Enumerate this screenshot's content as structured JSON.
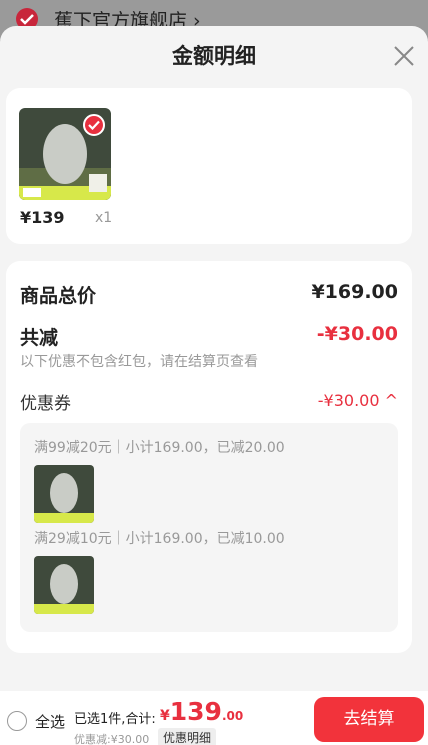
{
  "background": {
    "shop_name": "蕉下官方旗舰店 ›"
  },
  "sheet": {
    "title": "金额明细"
  },
  "product": {
    "price": "¥139",
    "qty": "x1"
  },
  "detail": {
    "total_label": "商品总价",
    "total_value": "¥169.00",
    "reduce_label": "共减",
    "reduce_value": "-¥30.00",
    "reduce_note": "以下优惠不包含红包，请在结算页查看",
    "coupon_label": "优惠券",
    "coupon_value": "-¥30.00 ^",
    "coupons": [
      {
        "rule": "满99减20元｜小计169.00，已减20.00"
      },
      {
        "rule": "满29减10元｜小计169.00，已减10.00"
      }
    ]
  },
  "bottom": {
    "select_all": "全选",
    "summary": "已选1件,合计:",
    "currency": "¥",
    "total_int": "139",
    "total_dec": ".00",
    "discount": "优惠减:¥30.00",
    "detail_link": "优惠明细",
    "checkout": "去结算"
  },
  "colors": {
    "accent_red": "#e8303f",
    "checkout_red": "#f2333b"
  }
}
